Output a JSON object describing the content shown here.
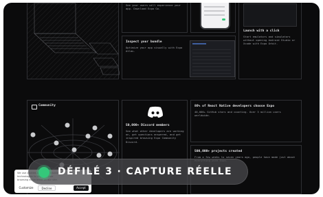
{
  "cards": {
    "top_left_text": "See your users will experience your app. Download Expo Go.",
    "bundle": {
      "title": "Inspect your bundle",
      "body": "Optimize your app visually with Expo Atlas."
    },
    "launch": {
      "title": "Launch with a click",
      "body": "Start emulators and simulators without opening Android Studio or Xcode with Expo Orbit."
    },
    "community": {
      "title": "Community",
      "icon": "community-icon"
    },
    "discord": {
      "title": "50,000+ Discord members",
      "body": "See what other developers are working on, get questions answered, and get inspired browsing Expo Community Discord.",
      "icon": "discord-icon"
    },
    "react_native": {
      "title": "86% of React Native developers choose Expo",
      "body": "40,000+ GitHub stars and counting. Over 3 million users worldwide."
    },
    "projects": {
      "title": "500,000+ projects created",
      "body": "From a few weeks to seven years ago, people have made just about everything with Expo."
    }
  },
  "cookie": {
    "text": "We use cookies and other tracking technologies to improve your browsing experience on our site.",
    "customize": "Customize",
    "decline": "Decline",
    "accept": "Accept"
  },
  "overlay": {
    "label": "DÉFILÉ 3 · CAPTURE RÉELLE"
  }
}
